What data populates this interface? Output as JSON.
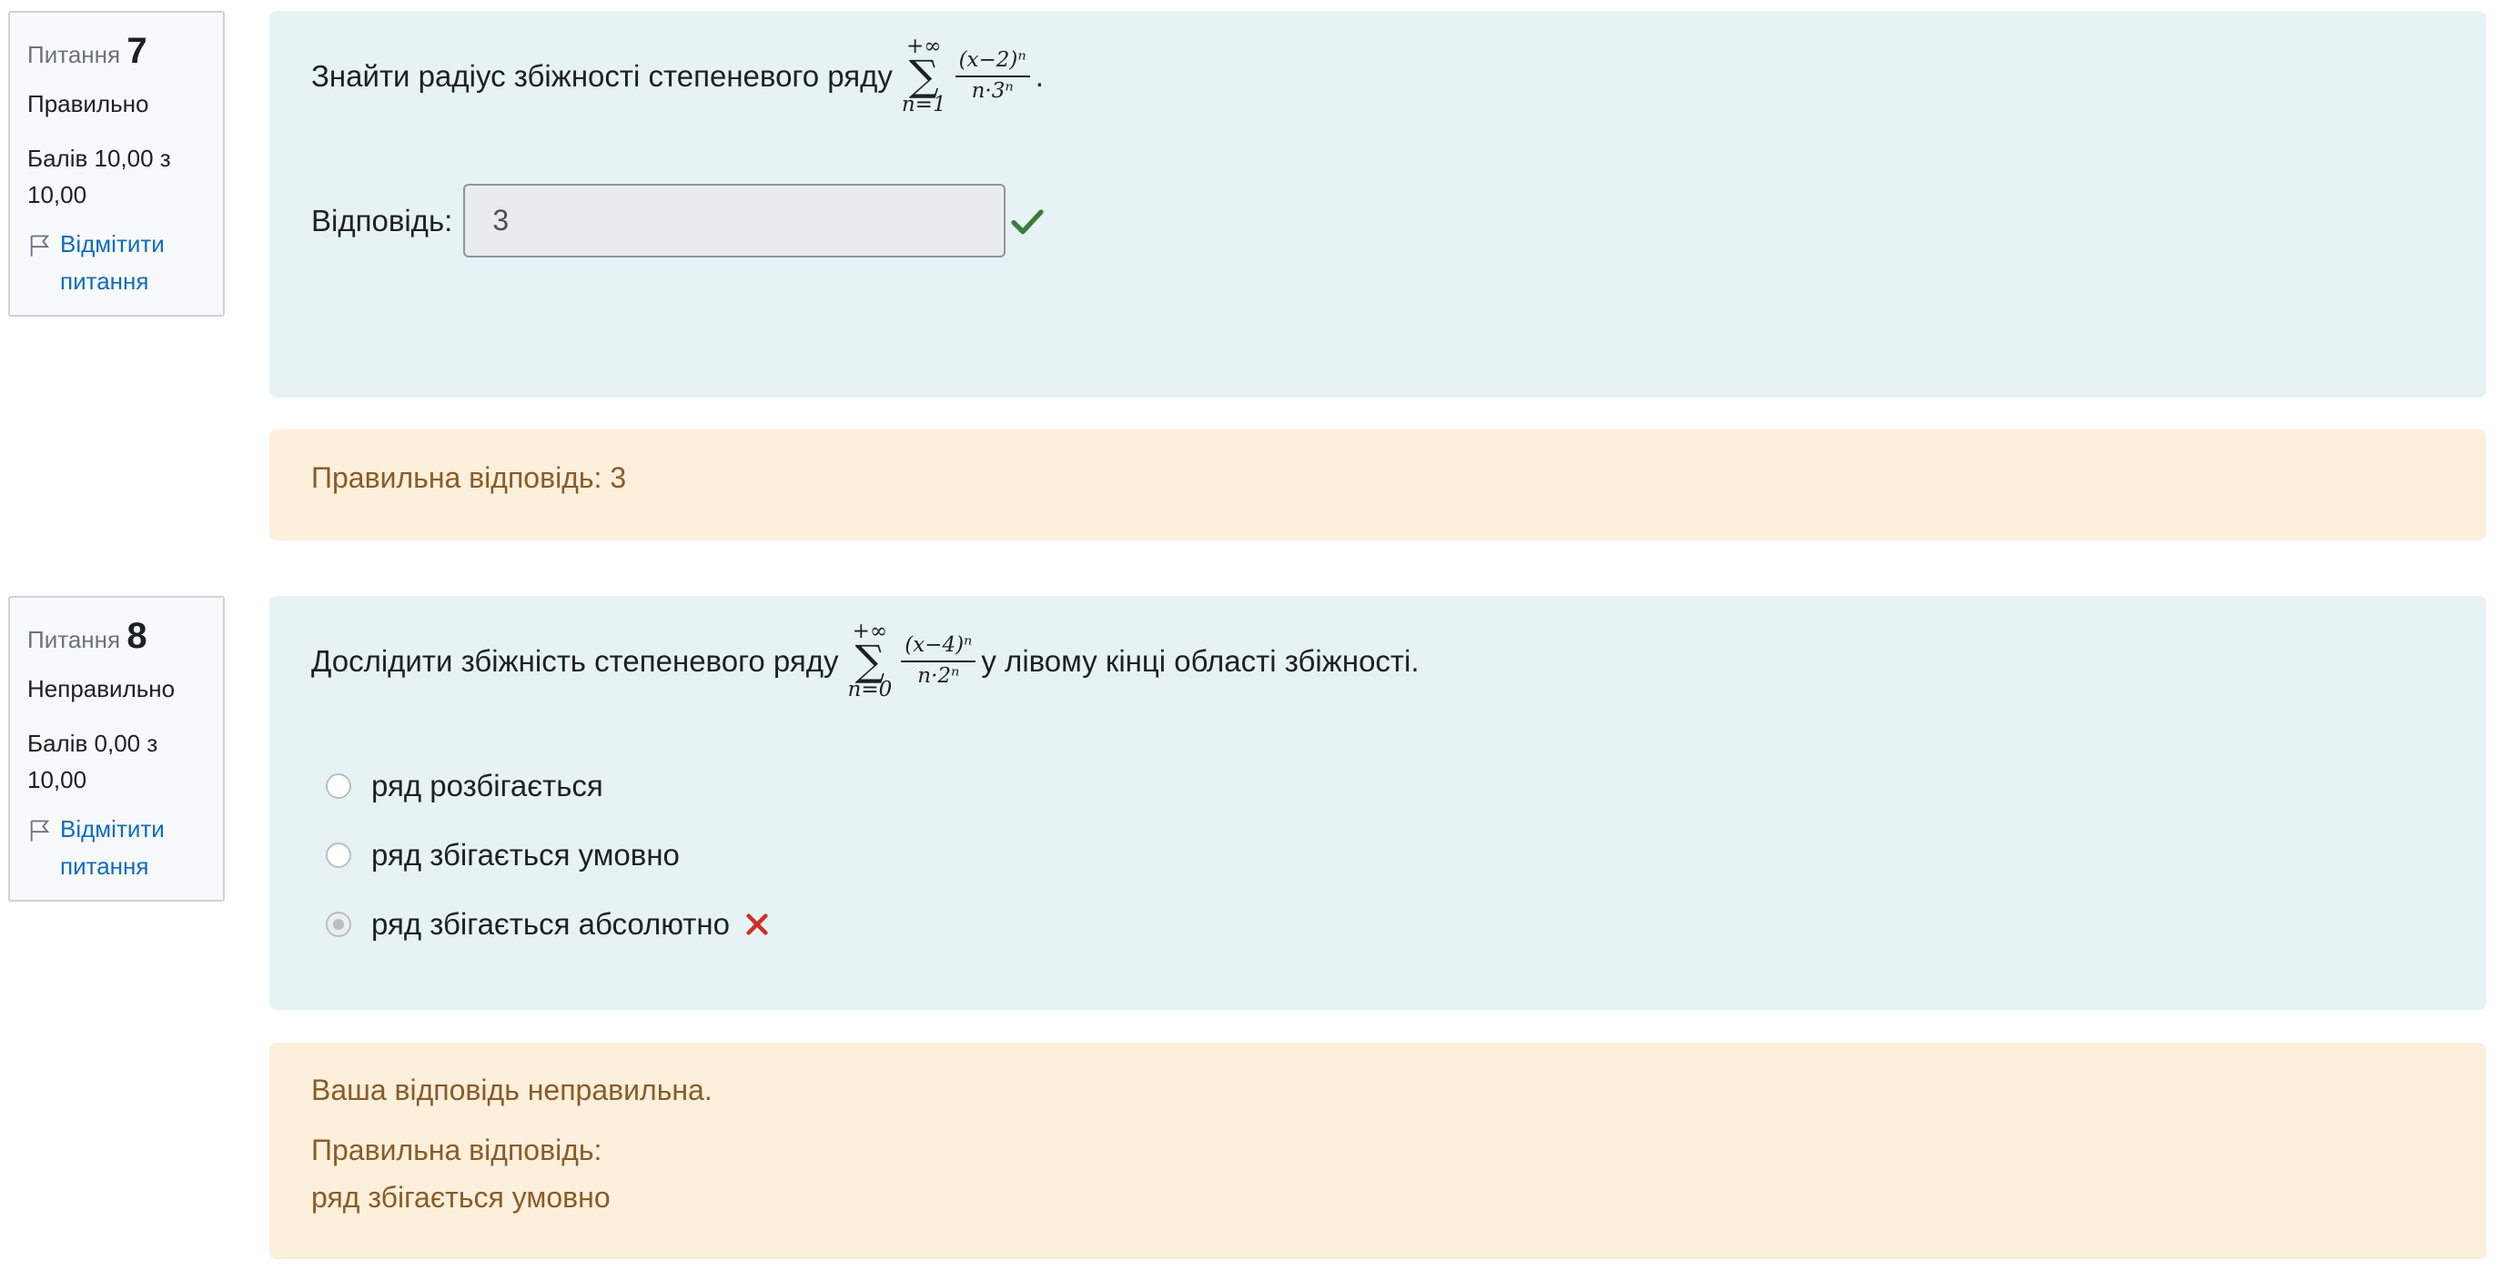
{
  "questions": [
    {
      "info": {
        "prefix": "Питання",
        "number": "7",
        "state": "Правильно",
        "grade": "Балів 10,00 з 10,00",
        "flag_label": "Відмітити питання"
      },
      "text_before": "Знайти радіус збіжності степеневого ряду",
      "formula": {
        "upper": "+∞",
        "sigma": "∑",
        "lower": "n=1",
        "numerator": "(x−2)ⁿ",
        "denominator": "n·3ⁿ"
      },
      "text_after": ".",
      "answer_label": "Відповідь:",
      "answer_value": "3",
      "answer_icon": "check-icon",
      "feedback": {
        "right_answer": "Правильна відповідь: 3"
      }
    },
    {
      "info": {
        "prefix": "Питання",
        "number": "8",
        "state": "Неправильно",
        "grade": "Балів 0,00 з 10,00",
        "flag_label": "Відмітити питання"
      },
      "text_before": "Дослідити збіжність степеневого ряду",
      "formula": {
        "upper": "+∞",
        "sigma": "∑",
        "lower": "n=0",
        "numerator": "(x−4)ⁿ",
        "denominator": "n·2ⁿ"
      },
      "text_after": "у лівому кінці області збіжності.",
      "options": [
        {
          "label": "ряд розбігається",
          "selected": false
        },
        {
          "label": "ряд збігається умовно",
          "selected": false
        },
        {
          "label": "ряд збігається абсолютно",
          "selected": true
        }
      ],
      "selected_icon": "cross-icon",
      "feedback": {
        "general": "Ваша відповідь неправильна.",
        "right_answer_title": "Правильна відповідь:",
        "right_answer_value": "ряд збігається умовно"
      }
    }
  ],
  "colors": {
    "formulation_bg": "#e6f2f4",
    "outcome_bg": "#fcefdc",
    "outcome_text": "#8a5c27",
    "link": "#0f6cbf",
    "correct": "#3a7d3a",
    "incorrect": "#ca3120"
  }
}
